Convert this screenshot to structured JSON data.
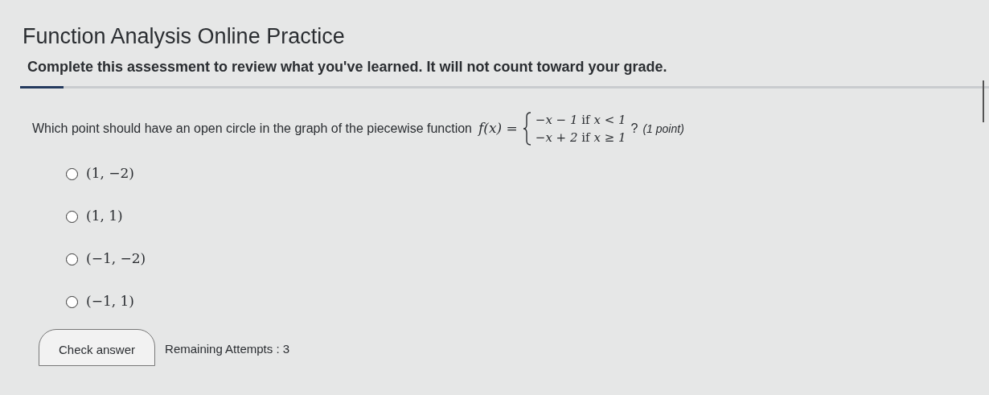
{
  "header": {
    "title": "Function Analysis Online Practice",
    "subtitle": "Complete this assessment to review what you've learned. It will not count toward your grade."
  },
  "progress": {
    "level": 0.045
  },
  "question": {
    "prompt": "Which point should have an open circle in the graph of the piecewise function",
    "lhs": "f(x) =",
    "cases": [
      {
        "expr": "−x − 1",
        "word": "if",
        "cond": "x < 1"
      },
      {
        "expr": "−x + 2",
        "word": "if",
        "cond": "x ≥ 1"
      }
    ],
    "mark": "?",
    "points": "(1 point)"
  },
  "options": [
    {
      "label": "(1, −2)",
      "selected": false
    },
    {
      "label": "(1, 1)",
      "selected": false
    },
    {
      "label": "(−1, −2)",
      "selected": false
    },
    {
      "label": "(−1, 1)",
      "selected": false
    }
  ],
  "check_button": "Check answer",
  "attempts": "Remaining Attempts : 3"
}
